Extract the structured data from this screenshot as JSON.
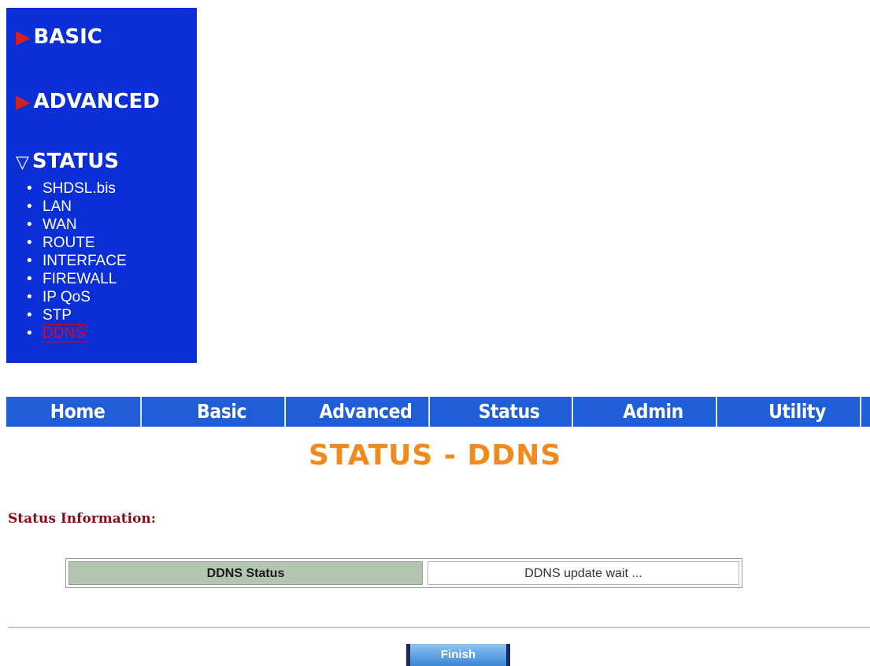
{
  "sidebar": {
    "sections": {
      "basic": {
        "label": "BASIC",
        "icon": "triangle-right-icon"
      },
      "advanced": {
        "label": "ADVANCED",
        "icon": "triangle-right-icon"
      },
      "status": {
        "label": "STATUS",
        "icon": "triangle-down-icon"
      }
    },
    "status_items": [
      "SHDSL.bis",
      "LAN",
      "WAN",
      "ROUTE",
      "INTERFACE",
      "FIREWALL",
      "IP QoS",
      "STP",
      "DDNS"
    ],
    "active_item": "DDNS",
    "colors": {
      "background": "#0a2fd6",
      "arrow": "#d32020",
      "active": "#d60a2a"
    }
  },
  "nav": {
    "items": [
      "Home",
      "Basic",
      "Advanced",
      "Status",
      "Admin",
      "Utility"
    ],
    "background": "#1e5fd8"
  },
  "page": {
    "title": "STATUS - DDNS",
    "info_heading": "Status Information:",
    "title_color": "#f08a1e"
  },
  "status_table": {
    "label": "DDNS Status",
    "value": "DDNS update wait ..."
  },
  "finish_button": {
    "label": "Finish"
  }
}
